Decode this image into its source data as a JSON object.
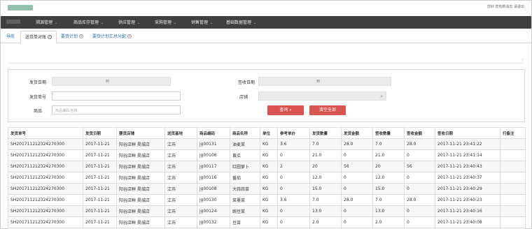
{
  "header": {
    "app_title": "和善果市场",
    "user_info": "您好 您有新消息 请退出"
  },
  "nav": {
    "brand": "菜单导航",
    "items": [
      {
        "label": "溯源管理"
      },
      {
        "label": "商品库存管理"
      },
      {
        "label": "供应管理"
      },
      {
        "label": "采购管理"
      },
      {
        "label": "销售管理"
      },
      {
        "label": "基础数据管理"
      }
    ]
  },
  "tabs": [
    {
      "label": "导航"
    },
    {
      "label": "送货单对账"
    },
    {
      "label": "要货计划"
    },
    {
      "label": "要货计划汇总分配"
    }
  ],
  "form": {
    "ship_date_label": "发货日期",
    "ship_date_sep": "到",
    "recv_date_label": "签收日期",
    "recv_date_sep": "到",
    "ship_no_label": "发货单号",
    "store_label": "店铺",
    "goods_label": "商品",
    "goods_placeholder": "商品编码/名称",
    "query_btn": "查询",
    "clear_btn": "清空全部"
  },
  "table": {
    "columns": [
      "发货单号",
      "发货日期",
      "要货店铺",
      "送货基地",
      "商品编码",
      "商品名称",
      "单位",
      "参考单价",
      "发货数量",
      "发货金额",
      "签收数量",
      "签收金额",
      "签收日期",
      "行备注"
    ],
    "rows": [
      [
        "SH20171121232427030​0",
        "2017-11-21",
        "阳谷店鲜 昊城店",
        "江苏",
        "jg00131",
        "油麦菜",
        "KG",
        "3.6",
        "7.0",
        "28.0",
        "7.0",
        "28.0",
        "2017-11-21 23:41:22",
        ""
      ],
      [
        "SH201711212324270300",
        "2017-11-21",
        "阳谷店鲜 昊城店",
        "江苏",
        "jg00106",
        "黄瓜",
        "KG",
        "0",
        "21.0",
        "0",
        "21.0",
        "0",
        "2017-11-21 23:41:14",
        ""
      ],
      [
        "SH201711212324270300",
        "2017-11-21",
        "阳谷店鲜 昊城店",
        "江苏",
        "jg00117",
        "红圆萝卜",
        "KG",
        "2",
        "20",
        "56",
        "20",
        "56",
        "2017-11-21 23:40:43",
        ""
      ],
      [
        "SH201711212324270300",
        "2017-11-21",
        "阳谷店鲜 昊城店",
        "江苏",
        "jg00116",
        "番茄",
        "KG",
        "0",
        "12.0",
        "0",
        "12.0",
        "0",
        "2017-11-21 23:40:37",
        ""
      ],
      [
        "SH201711212324270300",
        "2017-11-21",
        "阳谷店鲜 昊城店",
        "江苏",
        "jg00108",
        "大蒜蒜苗",
        "KG",
        "0",
        "15.0",
        "0",
        "15.0",
        "0",
        "2017-11-21 23:40:29",
        ""
      ],
      [
        "SH201711212324270300",
        "2017-11-21",
        "阳谷店鲜 昊城店",
        "江苏",
        "jg00130",
        "菜薹菜",
        "KG",
        "3.6",
        "7.0",
        "28.0",
        "7.0",
        "28.0",
        "2017-11-21 23:40:23",
        ""
      ],
      [
        "SH201711212324270300",
        "2017-11-21",
        "阳谷店鲜 昊城店",
        "江苏",
        "jg00124",
        "豌豆菜",
        "KG",
        "0",
        "13.0",
        "0",
        "13.0",
        "0",
        "2017-11-21 23:40:16",
        ""
      ],
      [
        "SH201711212324270300",
        "2017-11-21",
        "阳谷店鲜 昊城店",
        "江苏",
        "jg00132",
        "豆苗",
        "KG",
        "0",
        "2.0",
        "0",
        "2.0",
        "0",
        "2017-11-21 23:40:08",
        ""
      ],
      [
        "SH201711212324270300",
        "2017-11-21",
        "阳谷店鲜 昊城店",
        "江苏",
        "jg00109",
        "小油菜菜",
        "KG",
        "0",
        "21.0",
        "0",
        "21.0",
        "0",
        "2017-11-21 23:40:00",
        ""
      ]
    ]
  }
}
